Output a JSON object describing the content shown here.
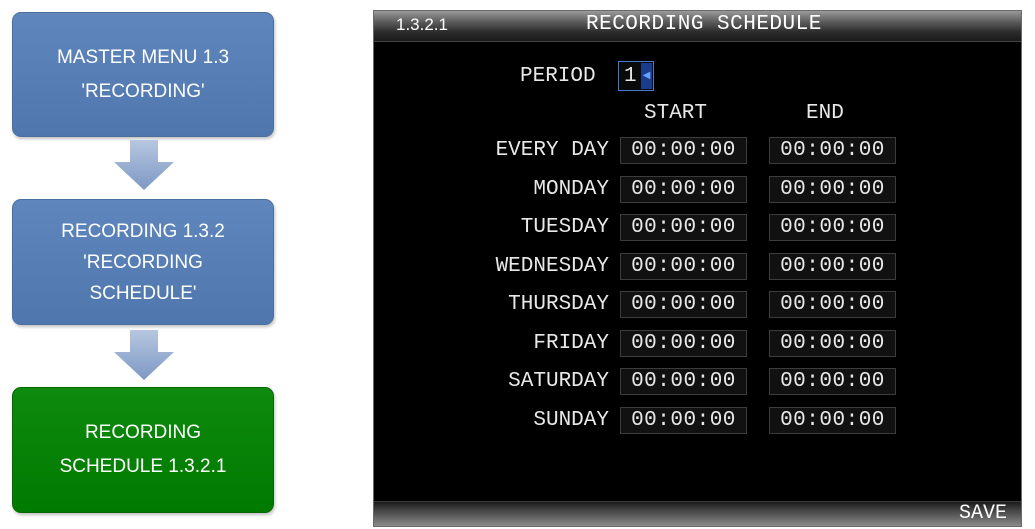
{
  "flow": {
    "step1": {
      "line1": "MASTER MENU 1.3",
      "line2": "'RECORDING'"
    },
    "step2": {
      "line1": "RECORDING 1.3.2",
      "line2": "'RECORDING",
      "line3": "SCHEDULE'"
    },
    "step3": {
      "line1": "RECORDING",
      "line2": "SCHEDULE 1.3.2.1"
    },
    "colors": {
      "blue": "#5b83b9",
      "green": "#008000",
      "arrow": "#8fa8cf"
    }
  },
  "dvr": {
    "menu_code": "1.3.2.1",
    "title": "RECORDING SCHEDULE",
    "period": {
      "label": "PERIOD",
      "value": "1",
      "arrow_icon": "dropdown-arrow"
    },
    "columns": {
      "start": "START",
      "end": "END"
    },
    "rows": [
      {
        "day": "EVERY DAY",
        "start": "00:00:00",
        "end": "00:00:00"
      },
      {
        "day": "MONDAY",
        "start": "00:00:00",
        "end": "00:00:00"
      },
      {
        "day": "TUESDAY",
        "start": "00:00:00",
        "end": "00:00:00"
      },
      {
        "day": "WEDNESDAY",
        "start": "00:00:00",
        "end": "00:00:00"
      },
      {
        "day": "THURSDAY",
        "start": "00:00:00",
        "end": "00:00:00"
      },
      {
        "day": "FRIDAY",
        "start": "00:00:00",
        "end": "00:00:00"
      },
      {
        "day": "SATURDAY",
        "start": "00:00:00",
        "end": "00:00:00"
      },
      {
        "day": "SUNDAY",
        "start": "00:00:00",
        "end": "00:00:00"
      }
    ],
    "save_label": "SAVE"
  }
}
